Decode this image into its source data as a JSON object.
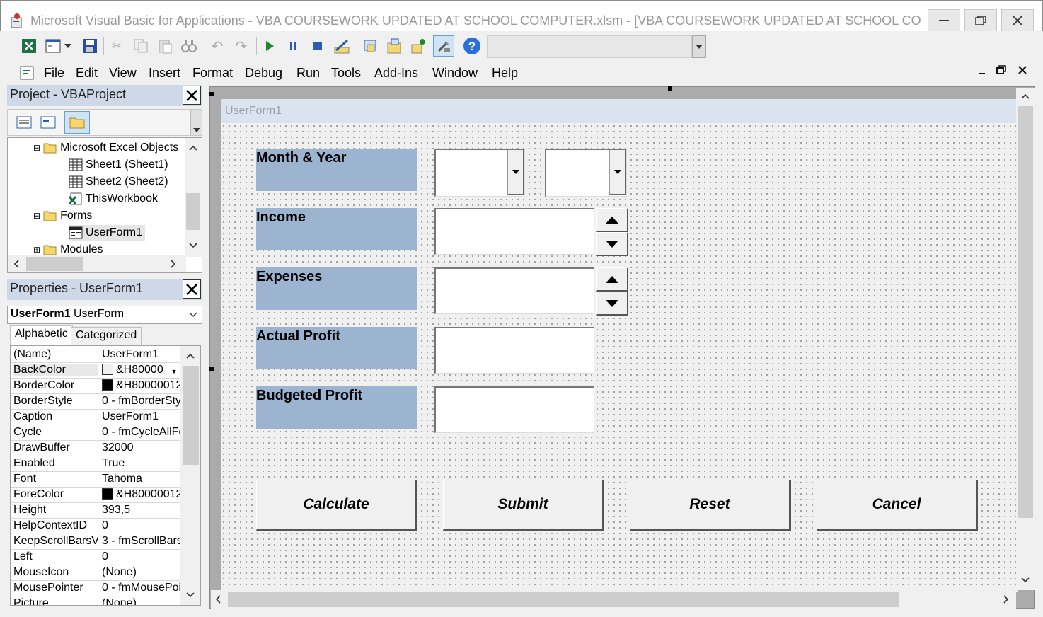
{
  "window": {
    "title": "Microsoft Visual Basic for Applications - VBA COURSEWORK UPDATED AT SCHOOL COMPUTER.xlsm - [VBA COURSEWORK UPDATED AT SCHOOL COMPUTE..."
  },
  "menu": {
    "items": [
      {
        "label": "File"
      },
      {
        "label": "Edit"
      },
      {
        "label": "View"
      },
      {
        "label": "Insert"
      },
      {
        "label": "Format"
      },
      {
        "label": "Debug"
      },
      {
        "label": "Run"
      },
      {
        "label": "Tools"
      },
      {
        "label": "Add-Ins"
      },
      {
        "label": "Window"
      },
      {
        "label": "Help"
      }
    ]
  },
  "project": {
    "title": "Project - VBAProject",
    "tree": [
      {
        "label": "Microsoft Excel Objects",
        "icon": "folder-open-icon"
      },
      {
        "label": "Sheet1 (Sheet1)",
        "icon": "sheet-icon"
      },
      {
        "label": "Sheet2 (Sheet2)",
        "icon": "sheet-icon"
      },
      {
        "label": "ThisWorkbook",
        "icon": "workbook-icon"
      },
      {
        "label": "Forms",
        "icon": "folder-open-icon"
      },
      {
        "label": "UserForm1",
        "icon": "form-icon"
      },
      {
        "label": "Modules",
        "icon": "folder-icon"
      }
    ]
  },
  "properties": {
    "title": "Properties - UserForm1",
    "object_name": "UserForm1",
    "object_type": "UserForm",
    "tabs": [
      "Alphabetic",
      "Categorized"
    ],
    "rows": [
      {
        "name": "(Name)",
        "value": "UserForm1"
      },
      {
        "name": "BackColor",
        "value": "&H80000",
        "swatch": "#f0f0f0"
      },
      {
        "name": "BorderColor",
        "value": "&H80000012",
        "swatch": "#000000"
      },
      {
        "name": "BorderStyle",
        "value": "0 - fmBorderSty"
      },
      {
        "name": "Caption",
        "value": "UserForm1"
      },
      {
        "name": "Cycle",
        "value": "0 - fmCycleAllFo"
      },
      {
        "name": "DrawBuffer",
        "value": "32000"
      },
      {
        "name": "Enabled",
        "value": "True"
      },
      {
        "name": "Font",
        "value": "Tahoma"
      },
      {
        "name": "ForeColor",
        "value": "&H80000012",
        "swatch": "#000000"
      },
      {
        "name": "Height",
        "value": "393,5"
      },
      {
        "name": "HelpContextID",
        "value": "0"
      },
      {
        "name": "KeepScrollBarsVis",
        "value": "3 - fmScrollBars"
      },
      {
        "name": "Left",
        "value": "0"
      },
      {
        "name": "MouseIcon",
        "value": "(None)"
      },
      {
        "name": "MousePointer",
        "value": "0 - fmMousePoi"
      },
      {
        "name": "Picture",
        "value": "(None)"
      }
    ]
  },
  "form": {
    "caption": "UserForm1",
    "labels": [
      "Month & Year",
      "Income",
      "Expenses",
      "Actual Profit",
      "Budgeted Profit"
    ],
    "buttons": [
      "Calculate",
      "Submit",
      "Reset",
      "Cancel"
    ],
    "label_color": "#9db4d1"
  }
}
